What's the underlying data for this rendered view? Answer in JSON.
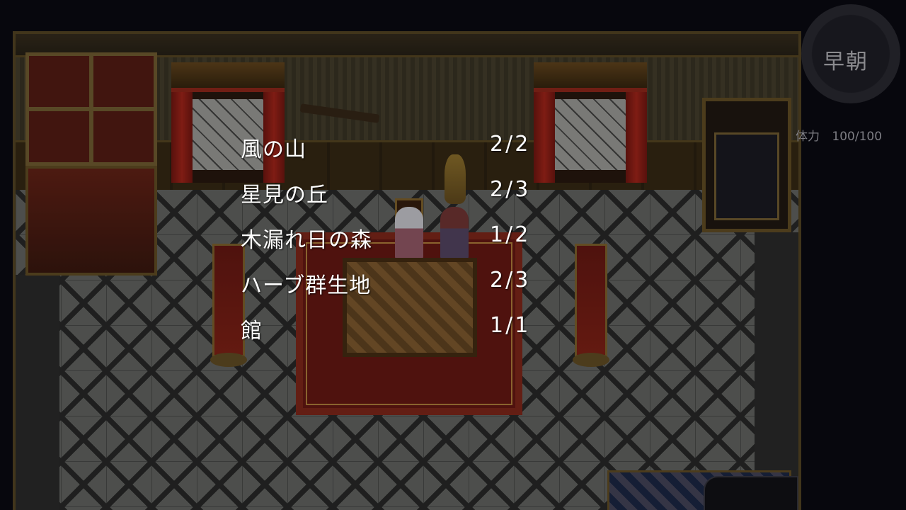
{
  "hud": {
    "time_of_day": "早朝",
    "stamina_label": "体力",
    "stamina_value": "100/100"
  },
  "areas": [
    {
      "name": "風の山",
      "progress": "2/2"
    },
    {
      "name": "星見の丘",
      "progress": "2/3"
    },
    {
      "name": "木漏れ日の森",
      "progress": "1/2"
    },
    {
      "name": "ハーブ群生地",
      "progress": "2/3"
    },
    {
      "name": "館",
      "progress": "1/1"
    }
  ]
}
